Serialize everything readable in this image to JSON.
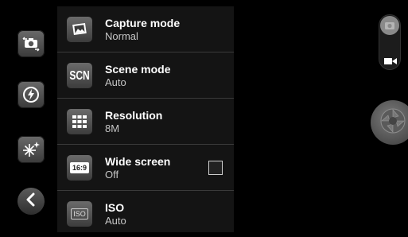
{
  "menu": {
    "items": [
      {
        "icon": "landscape-icon",
        "title": "Capture mode",
        "value": "Normal",
        "has_checkbox": false
      },
      {
        "icon": "scn-icon",
        "icon_text": "SCN",
        "title": "Scene mode",
        "value": "Auto",
        "has_checkbox": false
      },
      {
        "icon": "grid-icon",
        "title": "Resolution",
        "value": "8M",
        "has_checkbox": false
      },
      {
        "icon": "aspect-ratio-icon",
        "icon_text": "16:9",
        "title": "Wide screen",
        "value": "Off",
        "has_checkbox": true,
        "checked": false
      },
      {
        "icon": "iso-icon",
        "icon_text": "ISO",
        "title": "ISO",
        "value": "Auto",
        "has_checkbox": false
      }
    ]
  },
  "toolbar": {
    "icons": [
      "switch-camera-icon",
      "flash-auto-icon",
      "effects-icon",
      "back-icon"
    ]
  },
  "right_controls": {
    "icons": [
      "photo-mode-icon",
      "video-camera-icon",
      "shutter-icon"
    ]
  },
  "colors": {
    "background": "#000000",
    "panel": "#141414",
    "separator": "#3a3a3a",
    "secondary_text": "#c6c6c6"
  }
}
